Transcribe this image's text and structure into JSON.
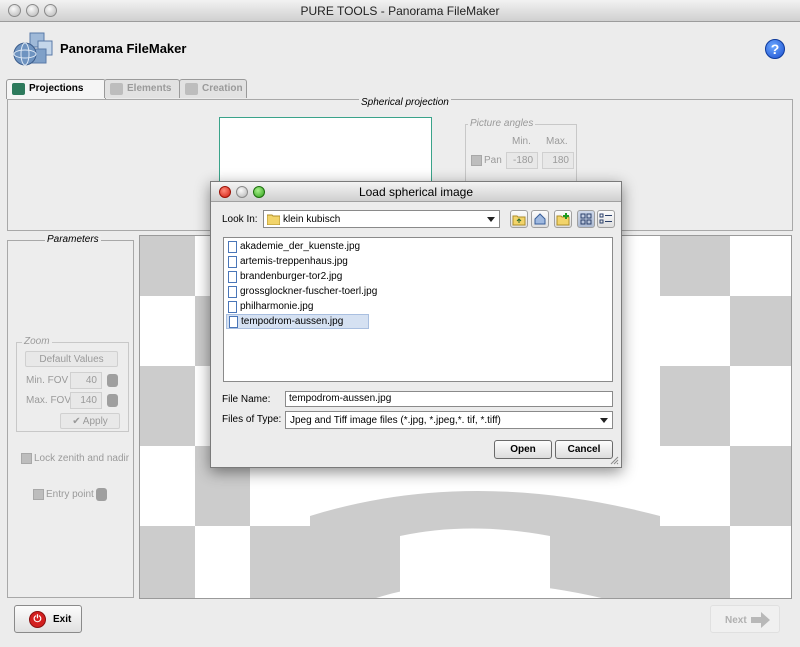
{
  "window": {
    "title": "PURE TOOLS - Panorama FileMaker"
  },
  "header": {
    "app_title": "Panorama FileMaker",
    "help_label": "?"
  },
  "tabs": [
    {
      "label": "Projections",
      "active": true
    },
    {
      "label": "Elements",
      "active": false
    },
    {
      "label": "Creation",
      "active": false
    }
  ],
  "spherical": {
    "group_title": "Spherical projection",
    "picture_angles": {
      "title": "Picture angles",
      "min_label": "Min.",
      "max_label": "Max.",
      "pan_label": "Pan",
      "pan_min": "-180",
      "pan_max": "180"
    }
  },
  "parameters": {
    "group_title": "Parameters",
    "zoom": {
      "title": "Zoom",
      "default_values_label": "Default Values",
      "min_fov_label": "Min. FOV",
      "min_fov_value": "40",
      "max_fov_label": "Max. FOV",
      "max_fov_value": "140",
      "apply_label": "Apply"
    },
    "lock_zenith_label": "Lock zenith and nadir",
    "entry_point_label": "Entry point"
  },
  "footer": {
    "exit_label": "Exit",
    "next_label": "Next"
  },
  "dialog": {
    "title": "Load spherical image",
    "look_in_label": "Look In:",
    "look_in_value": "klein kubisch",
    "files": [
      {
        "name": "akademie_der_kuenste.jpg",
        "selected": false
      },
      {
        "name": "artemis-treppenhaus.jpg",
        "selected": false
      },
      {
        "name": "brandenburger-tor2.jpg",
        "selected": false
      },
      {
        "name": "grossglockner-fuscher-toerl.jpg",
        "selected": false
      },
      {
        "name": "philharmonie.jpg",
        "selected": false
      },
      {
        "name": "tempodrom-aussen.jpg",
        "selected": true
      }
    ],
    "file_name_label": "File Name:",
    "file_name_value": "tempodrom-aussen.jpg",
    "file_types_label": "Files of Type:",
    "file_types_value": "Jpeg and Tiff image files (*.jpg, *.jpeg,*. tif, *.tiff)",
    "open_label": "Open",
    "cancel_label": "Cancel"
  },
  "colors": {
    "accent_blue": "#1c4fcf",
    "exit_red": "#d32020",
    "selection": "#d5e1f2"
  }
}
